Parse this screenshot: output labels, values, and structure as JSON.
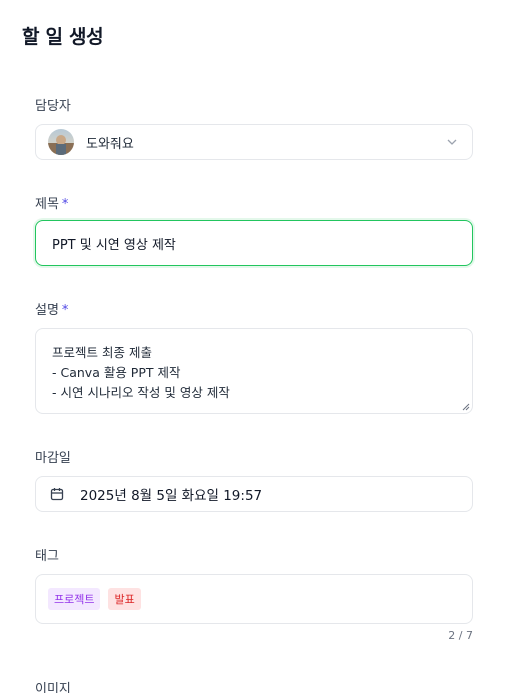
{
  "page": {
    "title": "할 일 생성"
  },
  "assignee": {
    "label": "담당자",
    "value": "도와줘요",
    "icon": "chevron-down-icon"
  },
  "title_field": {
    "label": "제목",
    "required_mark": "*",
    "value": "PPT 및 시연 영상 제작"
  },
  "description": {
    "label": "설명",
    "required_mark": "*",
    "lines": [
      "프로젝트 최종 제출",
      "- Canva 활용 PPT 제작",
      "- 시연 시나리오 작성 및 영상 제작"
    ]
  },
  "due_date": {
    "label": "마감일",
    "value": "2025년 8월 5일 화요일 19:57",
    "icon": "calendar-icon"
  },
  "tags": {
    "label": "태그",
    "items": [
      {
        "text": "프로젝트",
        "color": "#9333ea",
        "bg": "#f3e8ff"
      },
      {
        "text": "발표",
        "color": "#dc2626",
        "bg": "#fee2e2"
      }
    ],
    "count": "2 / 7"
  },
  "image": {
    "label": "이미지"
  },
  "colors": {
    "accent_focus": "#22c55e",
    "required": "#4f46e5"
  }
}
